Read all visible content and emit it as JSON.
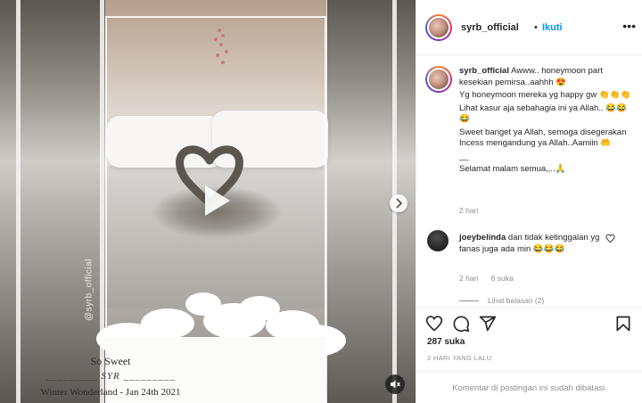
{
  "post": {
    "username": "syrb_official",
    "separator": "•",
    "follow_label": "Ikuti",
    "more_icon": "more-horizontal-icon"
  },
  "media": {
    "handle_overlay": "@syrb_official",
    "caption_title": "So Sweet",
    "caption_line": "_________ SYR _________",
    "caption_subtitle": "Winter Wonderland - Jan 24th 2021",
    "play_icon": "play-icon",
    "mute_icon": "speaker-muted-icon",
    "next_icon": "chevron-right-icon"
  },
  "caption": {
    "username": "syrb_official",
    "line1": "Awww.. honeymoon part kesekian pemirsa..aahhh 😍",
    "line2": "Yg honeymoon mereka yg happy gw 👏👏👏",
    "line3": "Lihat kasur aja sebahagia ini ya Allah.. 😂😂😂",
    "line4": "Sweet banget ya Allah, semoga disegerakan Incess mengandung ya Allah..Aamiin 🤲",
    "line5": "__",
    "line6": "Selamat malam semua,,..🙏",
    "time": "2 hari"
  },
  "comment": {
    "username": "joeybelinda",
    "text": "dan tidak ketinggalan yg fanas juga ada min 😂😂😂",
    "time": "2 hari",
    "likes": "6 suka",
    "view_replies": "Lihat balasan (2)"
  },
  "actions": {
    "like_icon": "heart-icon",
    "comment_icon": "comment-icon",
    "share_icon": "paper-plane-icon",
    "save_icon": "bookmark-icon",
    "likes_count": "287 suka",
    "time_ago": "2 HARI YANG LALU"
  },
  "footer": {
    "comments_disabled": "Komentar di postingan ini sudah dibatasi."
  }
}
